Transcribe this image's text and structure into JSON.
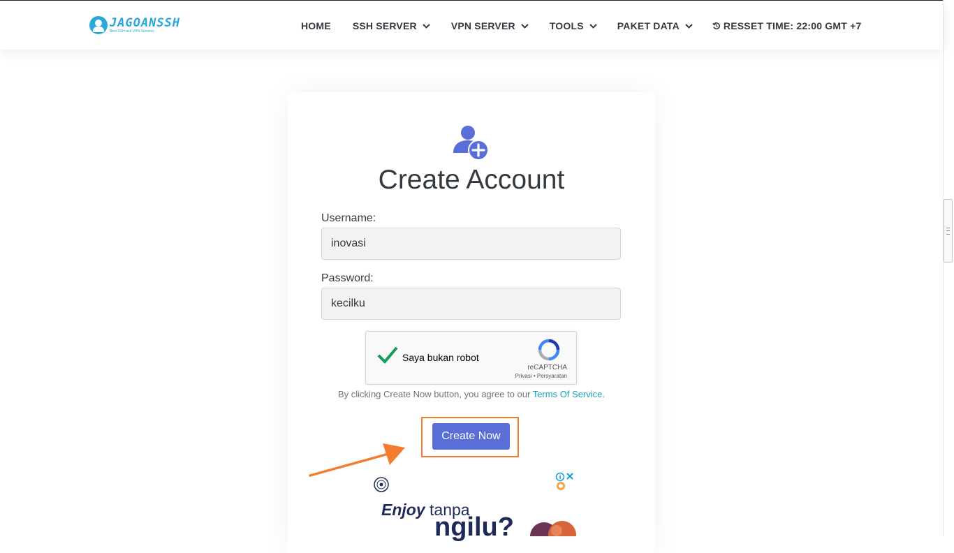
{
  "brand": {
    "name": "JAGOANSSH",
    "tagline": "Best SSH and VPN Services",
    "color": "#29a8dc"
  },
  "nav": {
    "items": [
      {
        "label": "HOME"
      },
      {
        "label": "SSH SERVER"
      },
      {
        "label": "VPN SERVER"
      },
      {
        "label": "TOOLS"
      },
      {
        "label": "PAKET DATA"
      }
    ],
    "reset": "RESSET TIME: 22:00 GMT +7"
  },
  "form": {
    "title": "Create Account",
    "username_label": "Username:",
    "username_value": "inovasi",
    "password_label": "Password:",
    "password_value": "kecilku",
    "captcha": {
      "label": "Saya bukan robot",
      "brand": "reCAPTCHA",
      "links": "Privasi • Persyaratan"
    },
    "terms_prefix": "By clicking Create Now button, you agree to our ",
    "terms_link": "Terms Of Service",
    "terms_suffix": ".",
    "submit_label": "Create Now",
    "accent_color": "#5a6ed8",
    "highlight_color": "#f47c30"
  },
  "ad": {
    "line1_em": "Enjoy",
    "line1_rest": " tanpa",
    "line2": "ngilu?"
  }
}
